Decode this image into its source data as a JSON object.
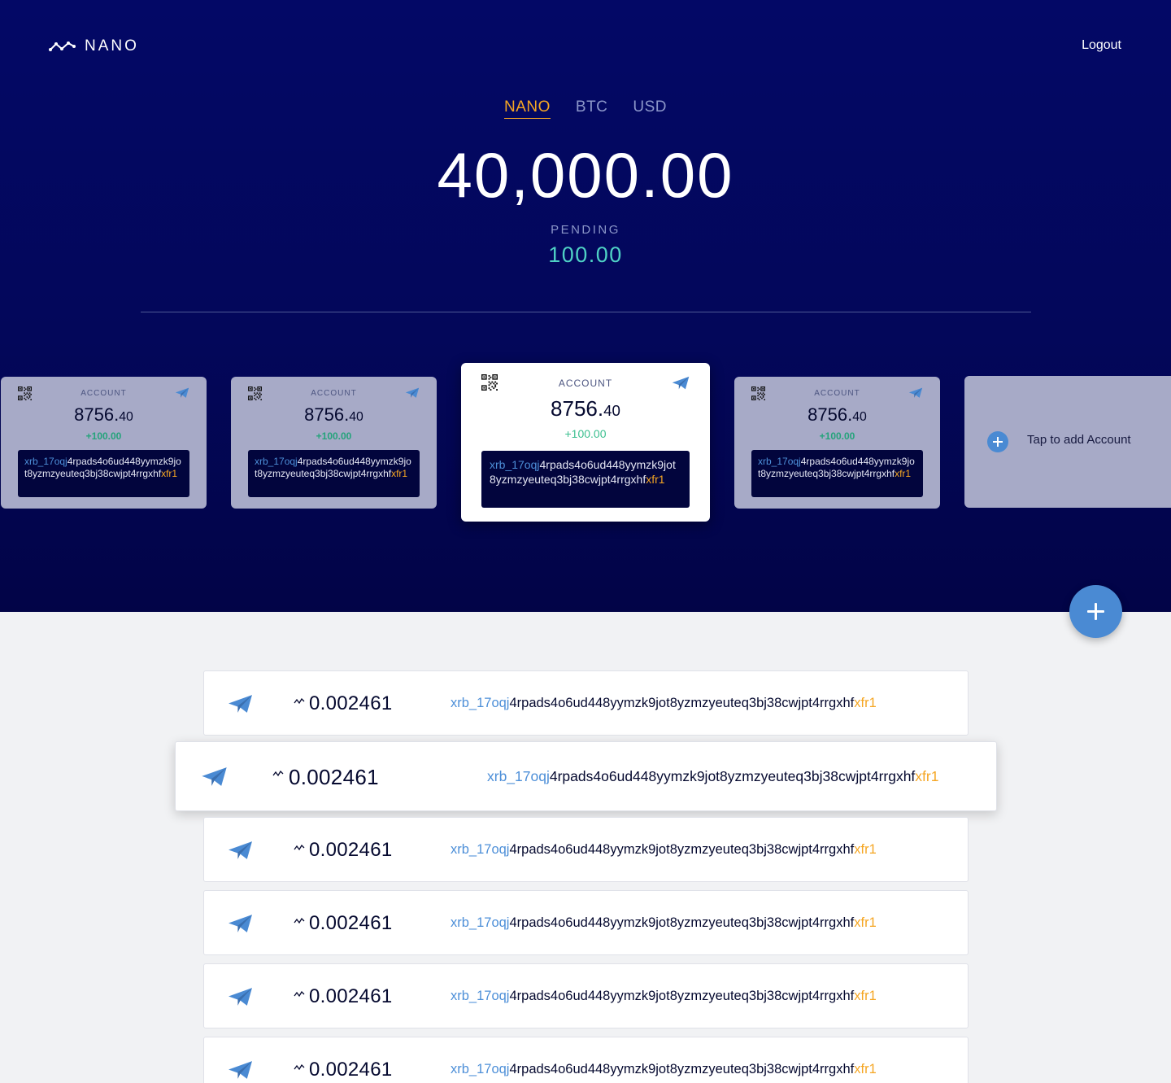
{
  "header": {
    "logo_text": "NANO",
    "logout_label": "Logout"
  },
  "currency_tabs": [
    {
      "label": "NANO",
      "active": true
    },
    {
      "label": "BTC",
      "active": false
    },
    {
      "label": "USD",
      "active": false
    }
  ],
  "balance": "40,000.00",
  "pending": {
    "label": "PENDING",
    "value": "100.00"
  },
  "accounts": [
    {
      "label": "ACCOUNT",
      "balance_int": "8756.",
      "balance_dec": "40",
      "pending": "+100.00",
      "address": {
        "prefix": "xrb_17oqj",
        "middle": "4rpads4o6ud448yymzk9jot8yzmzyeuteq3bj38cwjpt4rrgxhf",
        "suffix": "xfr1"
      },
      "active": false
    },
    {
      "label": "ACCOUNT",
      "balance_int": "8756.",
      "balance_dec": "40",
      "pending": "+100.00",
      "address": {
        "prefix": "xrb_17oqj",
        "middle": "4rpads4o6ud448yymzk9jot8yzmzyeuteq3bj38cwjpt4rrgxhf",
        "suffix": "xfr1"
      },
      "active": false
    },
    {
      "label": "ACCOUNT",
      "balance_int": "8756.",
      "balance_dec": "40",
      "pending": "+100.00",
      "address": {
        "prefix": "xrb_17oqj",
        "middle": "4rpads4o6ud448yymzk9jot8yzmzyeuteq3bj38cwjpt4rrgxhf",
        "suffix": "xfr1"
      },
      "active": true
    },
    {
      "label": "ACCOUNT",
      "balance_int": "8756.",
      "balance_dec": "40",
      "pending": "+100.00",
      "address": {
        "prefix": "xrb_17oqj",
        "middle": "4rpads4o6ud448yymzk9jot8yzmzyeuteq3bj38cwjpt4rrgxhf",
        "suffix": "xfr1"
      },
      "active": false
    }
  ],
  "add_account": {
    "label": "Tap to add Account",
    "icon": "plus-icon"
  },
  "fab": {
    "icon": "plus-icon"
  },
  "transactions": [
    {
      "amount": "0.002461",
      "address": {
        "prefix": "xrb_17oqj",
        "middle": "4rpads4o6ud448yymzk9jot8yzmzyeuteq3bj38cwjpt4rrgxhf",
        "suffix": "xfr1"
      },
      "icon": "send-icon"
    },
    {
      "amount": "0.002461",
      "address": {
        "prefix": "xrb_17oqj",
        "middle": "4rpads4o6ud448yymzk9jot8yzmzyeuteq3bj38cwjpt4rrgxhf",
        "suffix": "xfr1"
      },
      "icon": "send-icon",
      "highlighted": true
    },
    {
      "amount": "0.002461",
      "address": {
        "prefix": "xrb_17oqj",
        "middle": "4rpads4o6ud448yymzk9jot8yzmzyeuteq3bj38cwjpt4rrgxhf",
        "suffix": "xfr1"
      },
      "icon": "send-icon"
    },
    {
      "amount": "0.002461",
      "address": {
        "prefix": "xrb_17oqj",
        "middle": "4rpads4o6ud448yymzk9jot8yzmzyeuteq3bj38cwjpt4rrgxhf",
        "suffix": "xfr1"
      },
      "icon": "send-icon"
    },
    {
      "amount": "0.002461",
      "address": {
        "prefix": "xrb_17oqj",
        "middle": "4rpads4o6ud448yymzk9jot8yzmzyeuteq3bj38cwjpt4rrgxhf",
        "suffix": "xfr1"
      },
      "icon": "send-icon"
    },
    {
      "amount": "0.002461",
      "address": {
        "prefix": "xrb_17oqj",
        "middle": "4rpads4o6ud448yymzk9jot8yzmzyeuteq3bj38cwjpt4rrgxhf",
        "suffix": "xfr1"
      },
      "icon": "send-icon"
    }
  ],
  "colors": {
    "hero_bg": "#03075a",
    "accent": "#f5a623",
    "blue": "#4a8ad3",
    "pending": "#4fd1c5",
    "card_bg": "#a7aac7"
  }
}
